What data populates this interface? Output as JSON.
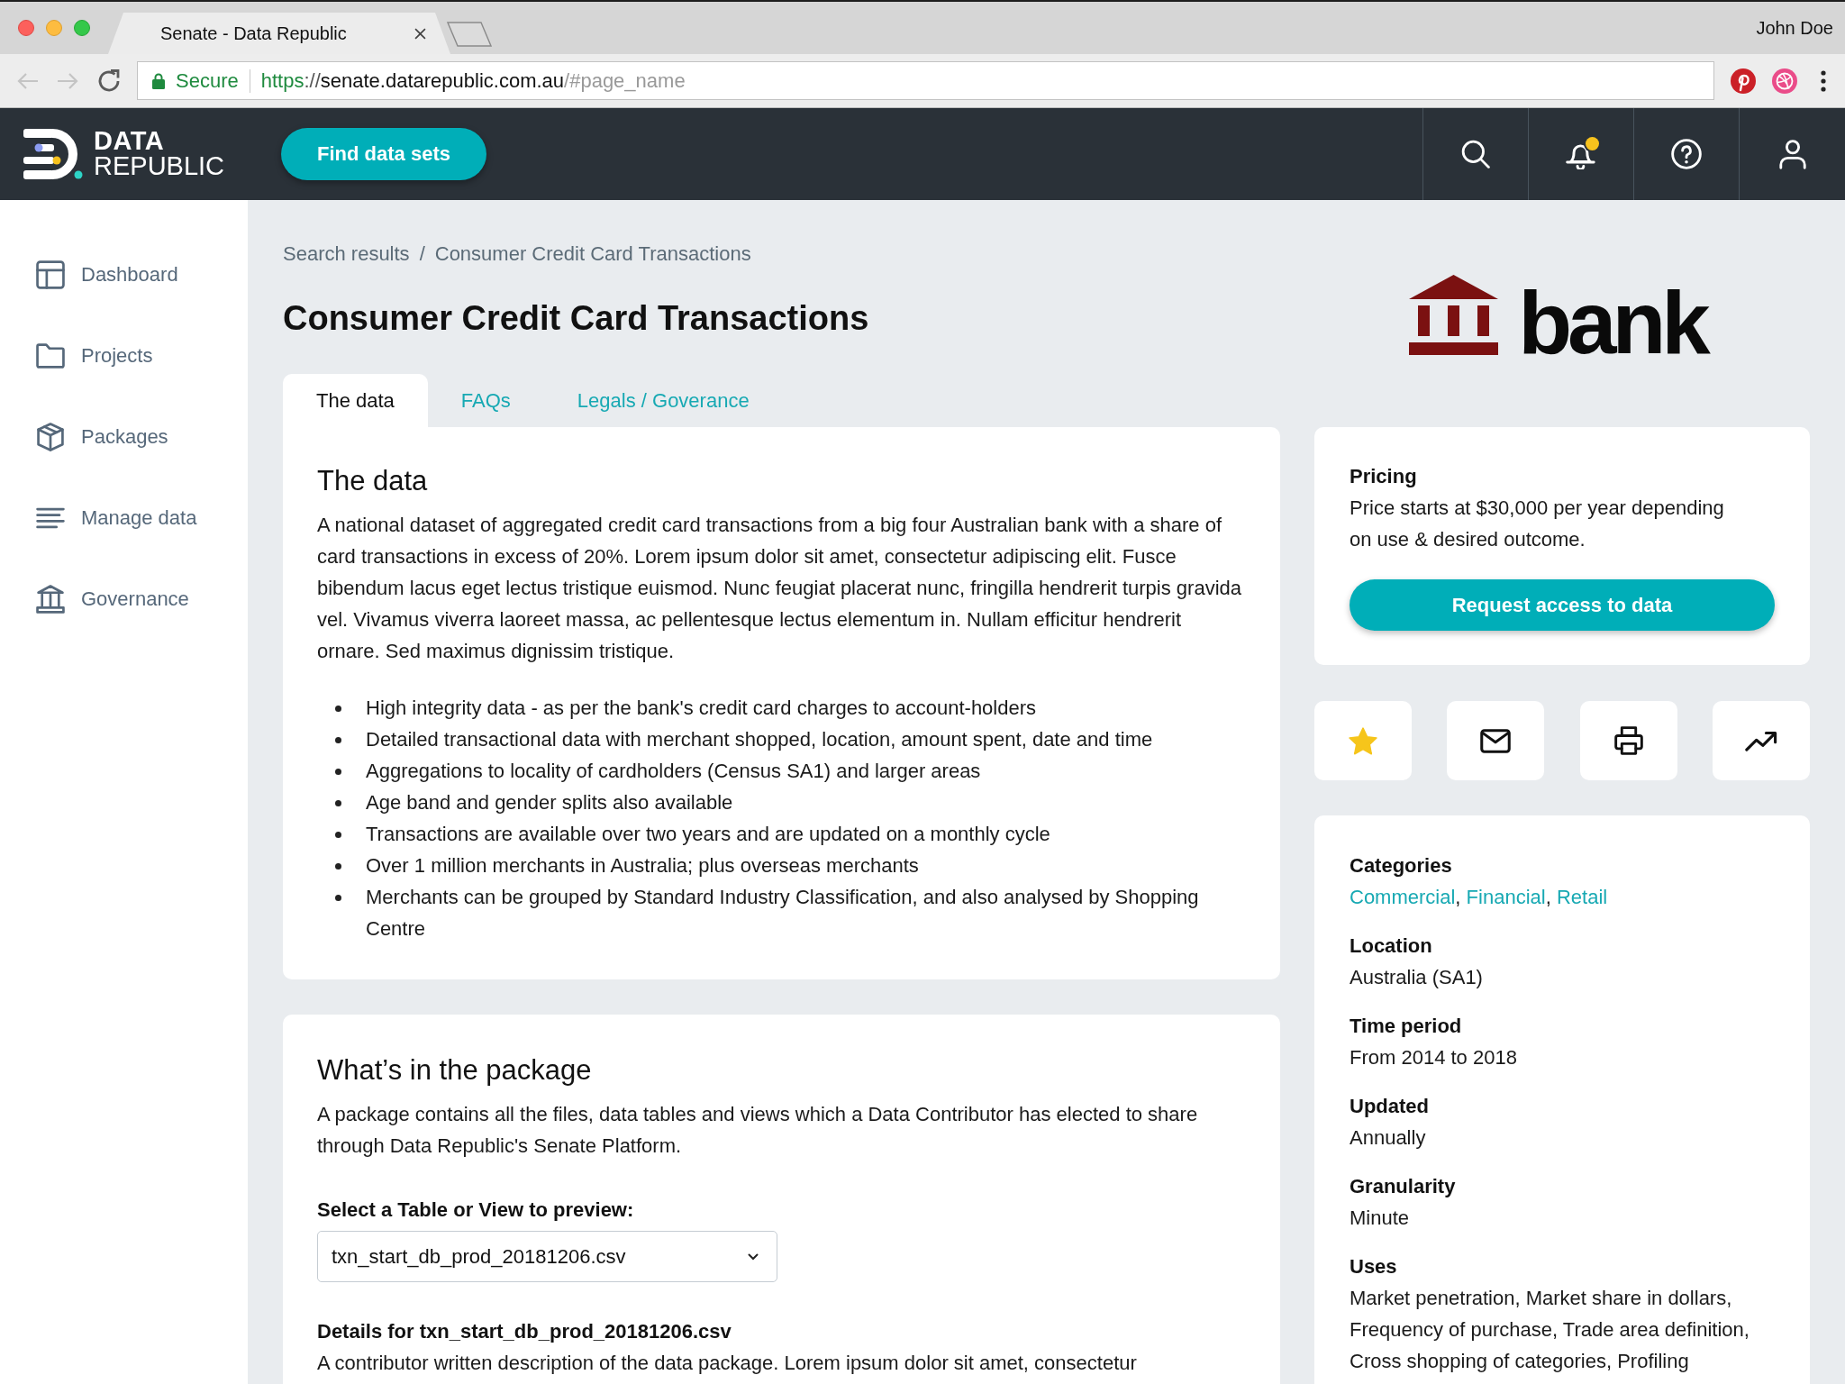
{
  "browser": {
    "tab_title": "Senate - Data Republic",
    "user_name": "John Doe",
    "security_label": "Secure",
    "url_parts": [
      {
        "text": "https",
        "kind": "scheme"
      },
      {
        "text": "://",
        "kind": "plain"
      },
      {
        "text": "senate.datarepublic.com.au",
        "kind": "host"
      },
      {
        "text": "/#page_name",
        "kind": "path"
      }
    ]
  },
  "header": {
    "brand": {
      "line_1": "DATA",
      "line_2": "REPUBLIC"
    },
    "find_button": "Find data sets",
    "notifications": true
  },
  "sidebar": {
    "items": [
      {
        "label": "Dashboard",
        "selected": false
      },
      {
        "label": "Projects",
        "selected": false
      },
      {
        "label": "Packages",
        "selected": false
      },
      {
        "label": "Manage data",
        "selected": false
      },
      {
        "label": "Governance",
        "selected": false
      }
    ]
  },
  "breadcrumb": {
    "items": [
      "Search results",
      "Consumer Credit Card Transactions"
    ],
    "separator": "/"
  },
  "title": "Consumer Credit Card Transactions",
  "provider_logo": {
    "text": "bank"
  },
  "tabs": [
    {
      "label": "The data",
      "selected": true
    },
    {
      "label": "FAQs",
      "selected": false
    },
    {
      "label": "Legals / Goverance",
      "selected": false
    }
  ],
  "overview": {
    "heading": "The data",
    "description": "A national dataset of aggregated credit card transactions from a big four Australian bank with a share of card transactions in excess of 20%. Lorem ipsum dolor sit amet, consectetur adipiscing elit. Fusce bibendum lacus eget lectus tristique euismod. Nunc feugiat placerat nunc, fringilla hendrerit turpis gravida vel. Vivamus viverra laoreet massa, ac pellentesque lectus elementum in. Nullam efficitur hendrerit ornare. Sed maximus dignissim tristique.",
    "highlights": [
      "High integrity data - as per the bank's credit card charges to account-holders",
      "Detailed transactional data with merchant shopped, location, amount spent, date and time",
      "Aggregations to locality of cardholders (Census SA1) and larger areas",
      "Age band and gender splits also available",
      "Transactions are available over two years and are updated on a monthly cycle",
      "Over 1 million merchants in Australia; plus overseas merchants",
      "Merchants can be grouped by Standard Industry Classification, and also analysed by Shopping Centre"
    ]
  },
  "package": {
    "heading": "What’s in the package",
    "description": "A package contains all the files, data tables and views which a Data Contributor has elected to share through Data Republic's Senate Platform.",
    "select_label": "Select a Table or View to preview:",
    "select_value": "txn_start_db_prod_20181206.csv",
    "details_heading": "Details for txn_start_db_prod_20181206.csv",
    "details_text": "A contributor written description of the data package. Lorem ipsum dolor sit amet, consectetur"
  },
  "pricing": {
    "heading": "Pricing",
    "text": "Price starts at $30,000 per year depending on use & desired outcome.",
    "button": "Request access to data"
  },
  "actions": {
    "starred": true
  },
  "details": [
    {
      "kind": "links",
      "label": "Categories",
      "links": [
        "Commercial",
        "Financial",
        "Retail"
      ],
      "separator": ","
    },
    {
      "kind": "text",
      "label": "Location",
      "value": "Australia (SA1)"
    },
    {
      "kind": "text",
      "label": "Time period",
      "value": "From 2014 to 2018"
    },
    {
      "kind": "text",
      "label": "Updated",
      "value": "Annually"
    },
    {
      "kind": "text",
      "label": "Granularity",
      "value": "Minute"
    },
    {
      "kind": "text",
      "label": "Uses",
      "value": "Market penetration, Market share in dollars, Frequency of purchase, Trade area definition, Cross shopping of categories, Profiling"
    }
  ]
}
